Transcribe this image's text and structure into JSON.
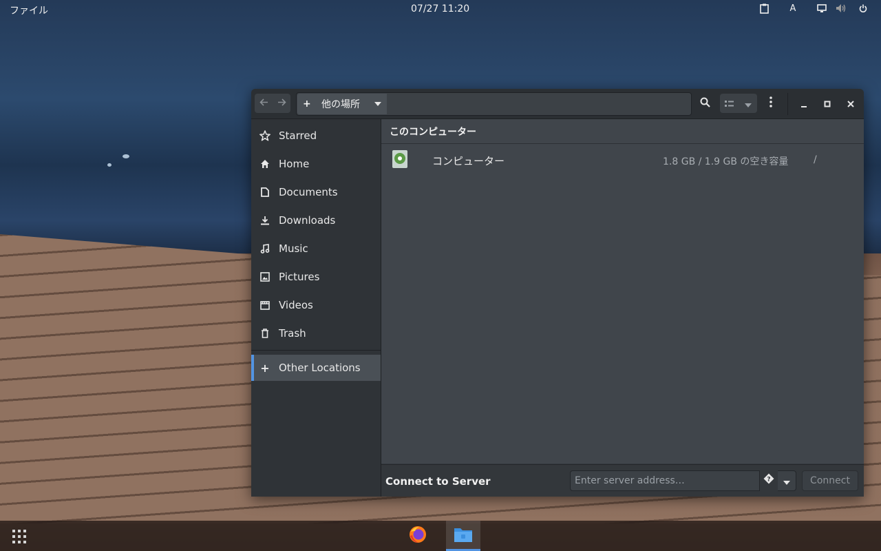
{
  "topbar": {
    "app_menu": "ファイル",
    "clock": "07/27  11:20",
    "tray": {
      "clipboard_icon": "clipboard-icon",
      "input_method": "A",
      "display_icon": "display-icon",
      "volume_icon": "volume-icon",
      "power_icon": "power-icon"
    }
  },
  "window": {
    "nav": {
      "back_icon": "arrow-left-icon",
      "forward_icon": "arrow-right-icon"
    },
    "path": {
      "icon": "+",
      "label": "他の場所"
    },
    "buttons": [
      "search-icon",
      "list-view-icon",
      "view-options-icon",
      "menu-icon",
      "minimize-icon",
      "maximize-icon",
      "close-icon"
    ]
  },
  "sidebar": {
    "items": [
      {
        "label": "Starred",
        "icon": "star-icon"
      },
      {
        "label": "Home",
        "icon": "home-icon"
      },
      {
        "label": "Documents",
        "icon": "document-icon"
      },
      {
        "label": "Downloads",
        "icon": "download-icon"
      },
      {
        "label": "Music",
        "icon": "music-icon"
      },
      {
        "label": "Pictures",
        "icon": "picture-icon"
      },
      {
        "label": "Videos",
        "icon": "video-icon"
      },
      {
        "label": "Trash",
        "icon": "trash-icon"
      }
    ],
    "other_locations": {
      "label": "Other Locations",
      "icon": "+"
    }
  },
  "main": {
    "section_title": "このコンピューター",
    "rows": [
      {
        "name": "コンピューター",
        "free": "1.8 GB / 1.9 GB の空き容量",
        "mount": "/",
        "icon": "drive-icon"
      }
    ]
  },
  "connect": {
    "label": "Connect to Server",
    "placeholder": "Enter server address…",
    "value": "",
    "button": "Connect"
  },
  "dock": {
    "apps": [
      "firefox-icon",
      "files-icon"
    ]
  },
  "colors": {
    "accent": "#5294e2",
    "window_bg": "#40454b",
    "sidebar_bg": "#2f3337",
    "headerbar_bg": "#2b2f33"
  }
}
